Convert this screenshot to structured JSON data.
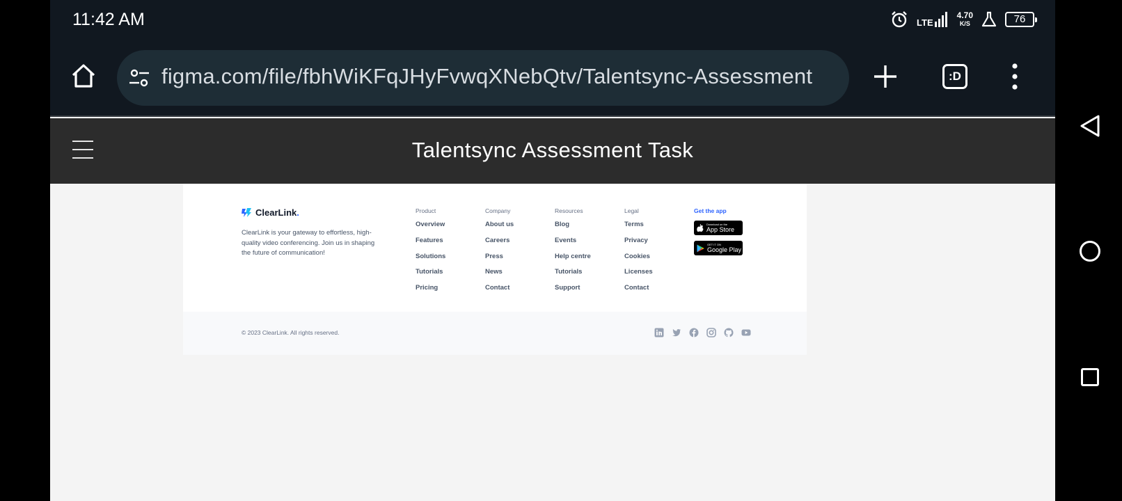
{
  "status_bar": {
    "time": "11:42 AM",
    "network": "LTE",
    "speed_value": "4.70",
    "speed_unit": "K/S",
    "battery": "76"
  },
  "browser": {
    "url": "figma.com/file/fbhWiKFqJHyFvwqXNebQtv/Talentsync-Assessment",
    "tabs_label": ":D"
  },
  "figma": {
    "title": "Talentsync Assessment Task"
  },
  "footer": {
    "brand": "ClearLink",
    "brand_dot": ".",
    "description": "ClearLink is your gateway to effortless, high-quality video conferencing. Join us in shaping the future of communication!",
    "columns": [
      {
        "heading": "Product",
        "items": [
          "Overview",
          "Features",
          "Solutions",
          "Tutorials",
          "Pricing"
        ]
      },
      {
        "heading": "Company",
        "items": [
          "About us",
          "Careers",
          "Press",
          "News",
          "Contact"
        ]
      },
      {
        "heading": "Resources",
        "items": [
          "Blog",
          "Events",
          "Help centre",
          "Tutorials",
          "Support"
        ]
      },
      {
        "heading": "Legal",
        "items": [
          "Terms",
          "Privacy",
          "Cookies",
          "Licenses",
          "Contact"
        ]
      }
    ],
    "get_app": {
      "heading": "Get the app",
      "app_store_small": "Download on the",
      "app_store_big": "App Store",
      "google_play_small": "GET IT ON",
      "google_play_big": "Google Play"
    },
    "copyright": "© 2023 ClearLink. All rights reserved.",
    "socials": [
      "linkedin-icon",
      "twitter-icon",
      "facebook-icon",
      "instagram-icon",
      "github-icon",
      "youtube-icon"
    ]
  },
  "colors": {
    "accent": "#2e64ff",
    "toolbar_bg": "#111820",
    "figma_header_bg": "#2c2c2c"
  }
}
